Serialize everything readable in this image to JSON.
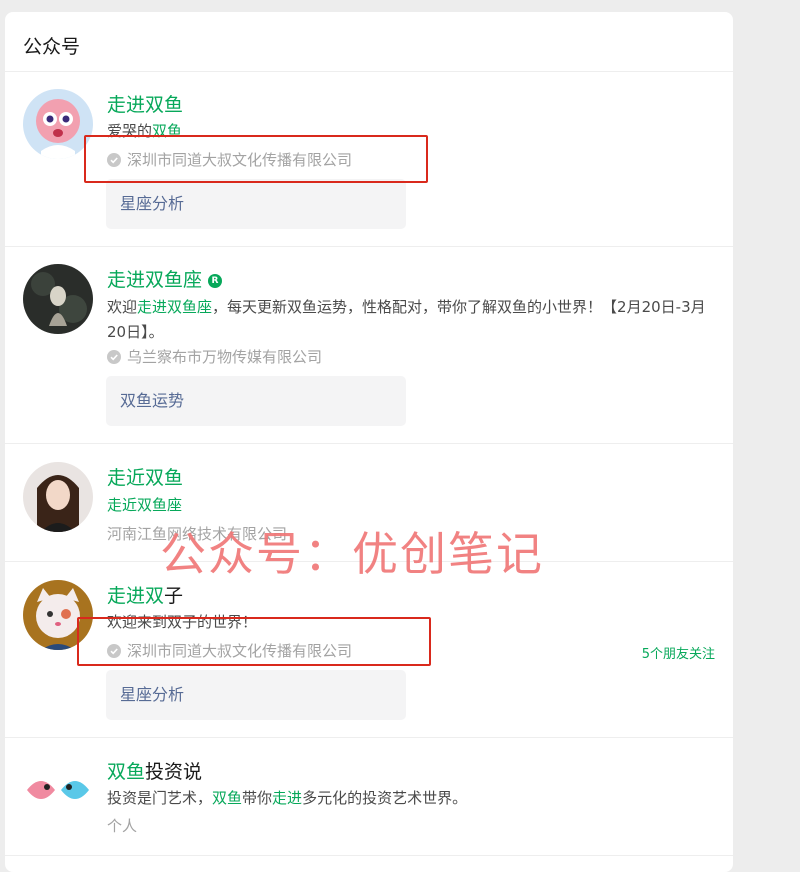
{
  "section": {
    "title": "公众号"
  },
  "accounts": [
    {
      "name_highlight": "走进双鱼",
      "name_rest": "",
      "desc_plain": "爱哭的",
      "desc_highlight": "双鱼",
      "verified_by": "深圳市同道大叔文化传播有限公司",
      "tag": "星座分析"
    },
    {
      "name_highlight": "走进双鱼座",
      "name_rest": "",
      "badge": "R",
      "desc_prefix": "欢迎",
      "desc_highlight": "走进双鱼座",
      "desc_suffix": "，每天更新双鱼运势，性格配对，带你了解双鱼的小世界！【2月20日-3月20日】。",
      "verified_by": "乌兰察布市万物传媒有限公司",
      "tag": "双鱼运势"
    },
    {
      "name_highlight": "走近双鱼",
      "name_rest": "",
      "desc_highlight": "走近双鱼座",
      "verified_by": "河南江鱼网络技术有限公司"
    },
    {
      "name_highlight": "走进双",
      "name_rest": "子",
      "desc_plain": "欢迎来到双子的世界！",
      "verified_by": "深圳市同道大叔文化传播有限公司",
      "friends": "5个朋友关注",
      "tag": "星座分析"
    },
    {
      "name_highlight": "双鱼",
      "name_rest": "投资说",
      "desc_prefix": "投资是门艺术，",
      "desc_highlight": "双鱼",
      "desc_mid": "带你",
      "desc_highlight2": "走进",
      "desc_suffix": "多元化的投资艺术世界。",
      "verified_by": "个人"
    }
  ],
  "watermark": "公众号：优创笔记",
  "colors": {
    "highlight": "#07a85a",
    "link": "#576b95",
    "annotation": "#d9291c"
  },
  "icons": {
    "verified": "verified-check-icon",
    "registered": "registered-badge-icon"
  }
}
